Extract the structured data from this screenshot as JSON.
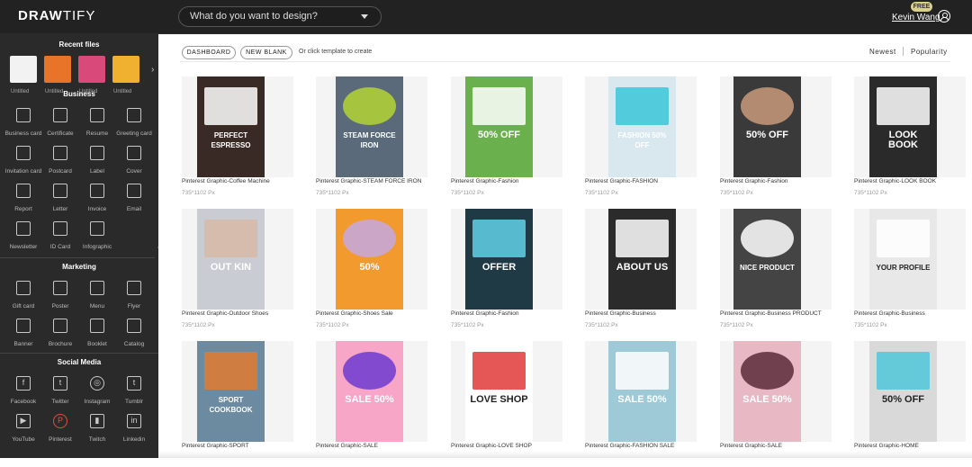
{
  "header": {
    "logo_bold": "DRAW",
    "logo_thin": "TIFY",
    "search_placeholder": "What do you want to design?",
    "badge": "FREE",
    "username": "Kevin Wang"
  },
  "sidebar": {
    "recent_title": "Recent files",
    "recent": [
      {
        "label": "Untitled",
        "color": "#f2f2f2"
      },
      {
        "label": "Untitled",
        "color": "#e8742a"
      },
      {
        "label": "Untitled",
        "color": "#d94a7a"
      },
      {
        "label": "Untitled",
        "color": "#f0b030"
      }
    ],
    "sections": [
      {
        "title": "Business",
        "items": [
          "Business card",
          "Certificate",
          "Resume",
          "Greeting card",
          "Invitation card",
          "Postcard",
          "Label",
          "Cover",
          "Report",
          "Letter",
          "Invoice",
          "Email",
          "Newsletter",
          "ID Card",
          "Infographic"
        ]
      },
      {
        "title": "Marketing",
        "items": [
          "Gift card",
          "Poster",
          "Menu",
          "Flyer",
          "Banner",
          "Brochure",
          "Booklet",
          "Catalog"
        ]
      },
      {
        "title": "Social Media",
        "items": [
          "Facebook",
          "Twitter",
          "Instagram",
          "Tumblr",
          "YouTube",
          "Pinterest",
          "Twitch",
          "Linkedin"
        ]
      }
    ]
  },
  "toolbar": {
    "dashboard": "DASHBOARD",
    "new_blank": "NEW BLANK",
    "hint": "Or click template to create",
    "sort_newest": "Newest",
    "sort_popularity": "Popularity"
  },
  "templates": [
    {
      "name": "Pinterest Graphic-Coffee Machine",
      "size": "735*1102 Px",
      "bg": "#3a2a25",
      "accent": "#ffffff",
      "text": "PERFECT ESPRESSO"
    },
    {
      "name": "Pinterest Graphic-STEAM FORCE IRON",
      "size": "735*1102 Px",
      "bg": "#5a6a7a",
      "accent": "#b5d334",
      "text": "STEAM FORCE IRON"
    },
    {
      "name": "Pinterest Graphic-Fashion",
      "size": "735*1102 Px",
      "bg": "#6ab04c",
      "accent": "#ffffff",
      "text": "50% OFF"
    },
    {
      "name": "Pinterest Graphic-FASHION",
      "size": "735*1102 Px",
      "bg": "#d9e8ee",
      "accent": "#39c5d8",
      "text": "FASHION 50% OFF"
    },
    {
      "name": "Pinterest Graphic-Fashion",
      "size": "735*1102 Px",
      "bg": "#3a3a3a",
      "accent": "#c89a7a",
      "text": "50% OFF"
    },
    {
      "name": "Pinterest Graphic-LOOK BOOK",
      "size": "735*1102 Px",
      "bg": "#2a2a2a",
      "accent": "#ffffff",
      "text": "LOOK BOOK"
    },
    {
      "name": "Pinterest Graphic-Outdoor Shoes",
      "size": "735*1102 Px",
      "bg": "#c9ccd2",
      "accent": "#d8b9a6",
      "text": "OUT KIN"
    },
    {
      "name": "Pinterest Graphic-Shoes Sale",
      "size": "735*1102 Px",
      "bg": "#f29a2e",
      "accent": "#c4a8e0",
      "text": "50%"
    },
    {
      "name": "Pinterest Graphic-Fashion",
      "size": "735*1102 Px",
      "bg": "#1f3a44",
      "accent": "#62d1e6",
      "text": "OFFER"
    },
    {
      "name": "Pinterest Graphic-Business",
      "size": "735*1102 Px",
      "bg": "#2b2b2b",
      "accent": "#ffffff",
      "text": "ABOUT US"
    },
    {
      "name": "Pinterest Graphic-Business PRODUCT",
      "size": "735*1102 Px",
      "bg": "#444444",
      "accent": "#ffffff",
      "text": "NICE PRODUCT"
    },
    {
      "name": "Pinterest Graphic-Business",
      "size": "735*1102 Px",
      "bg": "#e8e8e8",
      "accent": "#ffffff",
      "text": "YOUR PROFILE"
    },
    {
      "name": "Pinterest Graphic-SPORT",
      "size": "735*1102 Px",
      "bg": "#6c8aa0",
      "accent": "#e07a2f",
      "text": "SPORT COOKBOOK"
    },
    {
      "name": "Pinterest Graphic-SALE",
      "size": "735*1102 Px",
      "bg": "#f7a6c8",
      "accent": "#6d3ad0",
      "text": "SALE 50%"
    },
    {
      "name": "Pinterest Graphic-LOVE SHOP",
      "size": "735*1102 Px",
      "bg": "#ffffff",
      "accent": "#e03a3a",
      "text": "LOVE SHOP"
    },
    {
      "name": "Pinterest Graphic-FASHION SALE",
      "size": "735*1102 Px",
      "bg": "#9ec9d6",
      "accent": "#ffffff",
      "text": "SALE 50%"
    },
    {
      "name": "Pinterest Graphic-SALE",
      "size": "735*1102 Px",
      "bg": "#e8b8c4",
      "accent": "#5a2a3a",
      "text": "SALE 50%"
    },
    {
      "name": "Pinterest Graphic-HOME",
      "size": "735*1102 Px",
      "bg": "#d9d9d9",
      "accent": "#4fc6d8",
      "text": "50% OFF"
    }
  ]
}
